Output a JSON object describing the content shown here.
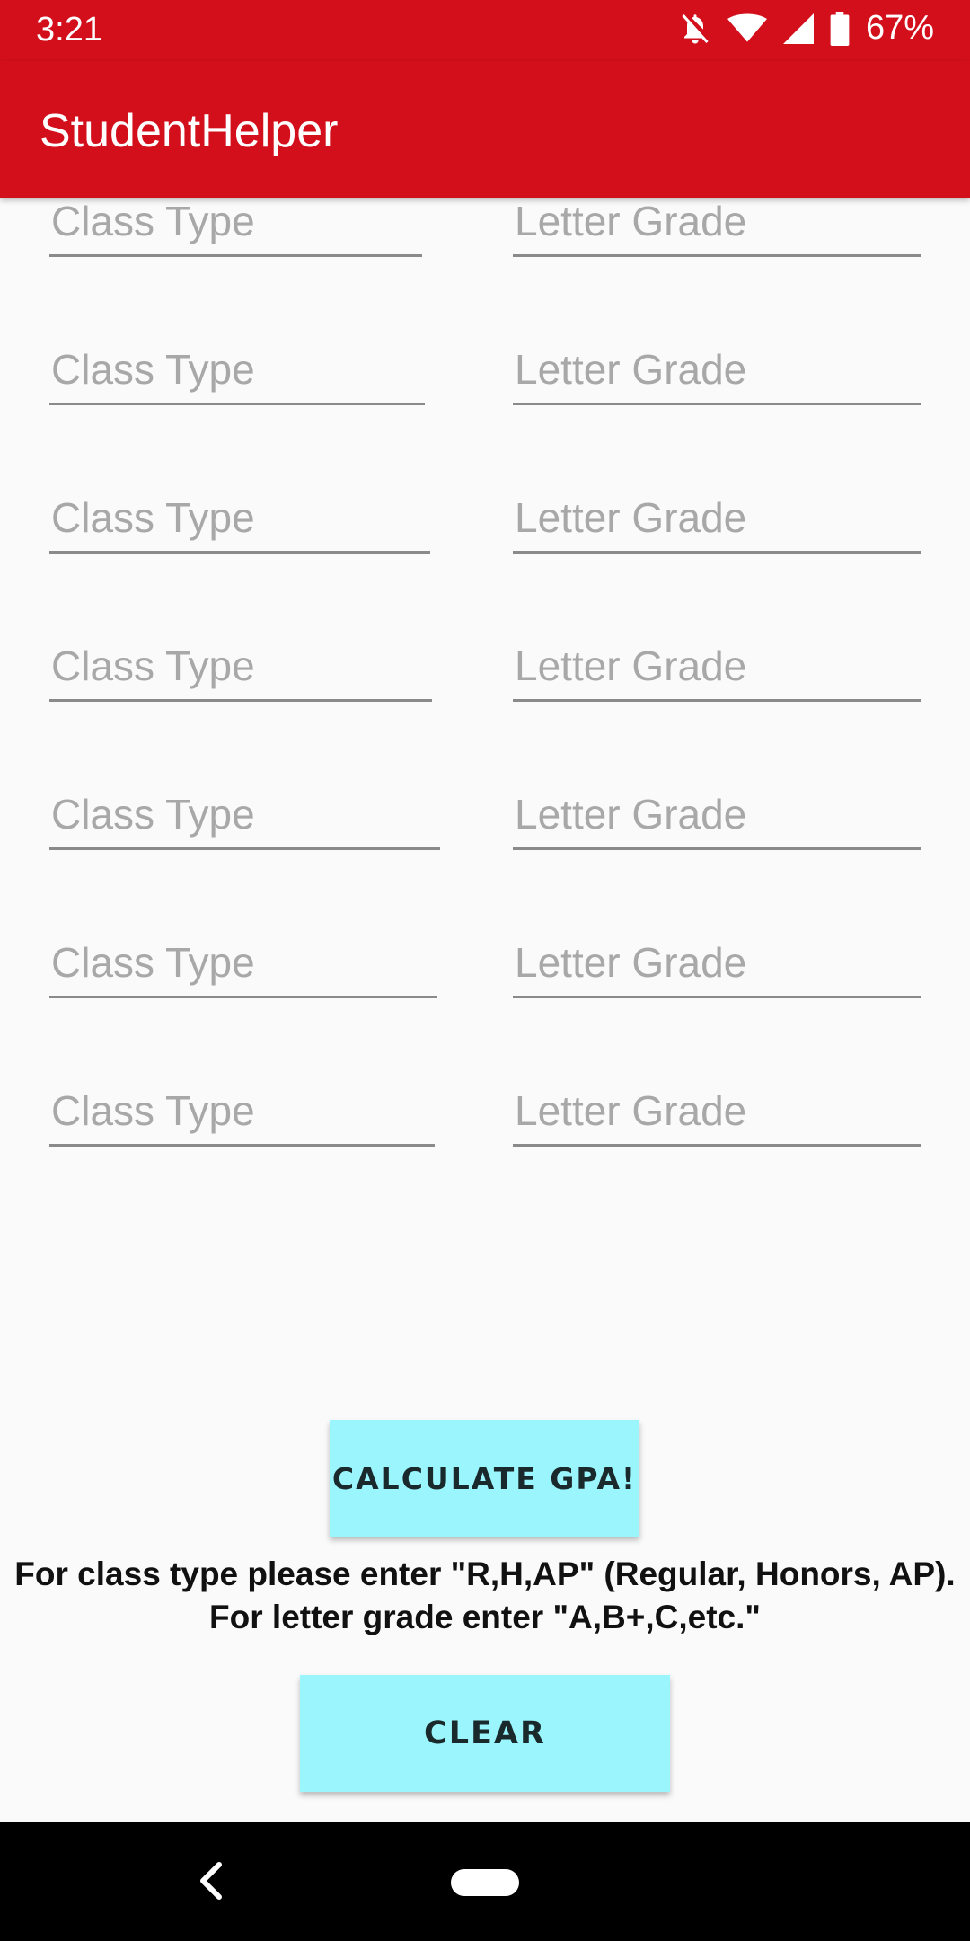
{
  "status_bar": {
    "time": "3:21",
    "battery_percent": "67%",
    "icons": [
      "notifications-off-icon",
      "wifi-icon",
      "cell-signal-icon",
      "battery-icon"
    ]
  },
  "app_bar": {
    "title": "StudentHelper",
    "color": "#d30f1c"
  },
  "form": {
    "rows": [
      {
        "class_type_placeholder": "Class Type",
        "letter_grade_placeholder": "Letter Grade"
      },
      {
        "class_type_placeholder": "Class Type",
        "letter_grade_placeholder": "Letter Grade"
      },
      {
        "class_type_placeholder": "Class Type",
        "letter_grade_placeholder": "Letter Grade"
      },
      {
        "class_type_placeholder": "Class Type",
        "letter_grade_placeholder": "Letter Grade"
      },
      {
        "class_type_placeholder": "Class Type",
        "letter_grade_placeholder": "Letter Grade"
      },
      {
        "class_type_placeholder": "Class Type",
        "letter_grade_placeholder": "Letter Grade"
      },
      {
        "class_type_placeholder": "Class Type",
        "letter_grade_placeholder": "Letter Grade"
      }
    ]
  },
  "buttons": {
    "calculate_label": "Calculate GPA!",
    "clear_label": "Clear",
    "color": "#9bf5fd"
  },
  "instructions": {
    "line1": "For class type please enter \"R,H,AP\" (Regular, Honors, AP).",
    "line2": "For letter grade enter \"A,B+,C,etc.\""
  },
  "nav_bar": {
    "icons": [
      "back-icon",
      "home-pill-icon"
    ]
  }
}
